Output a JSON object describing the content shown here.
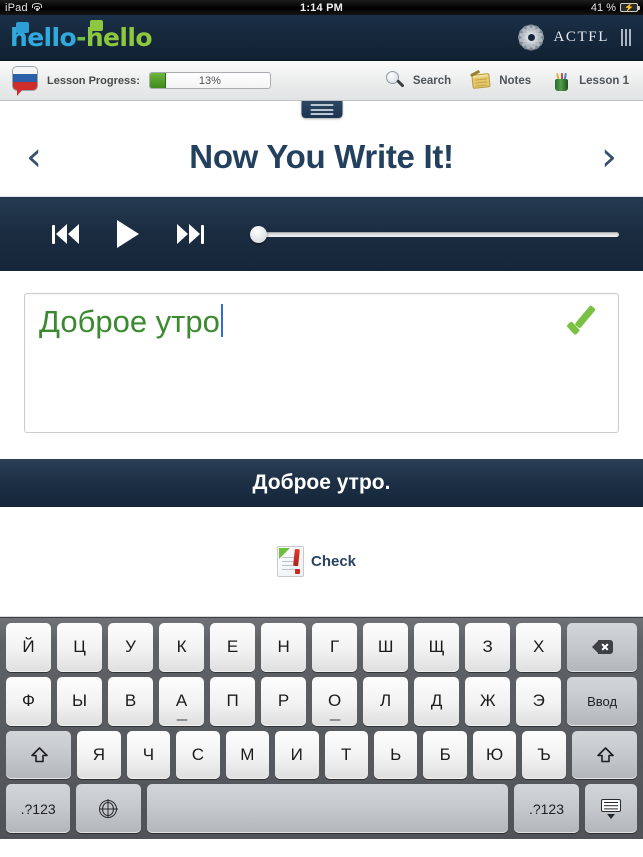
{
  "status_bar": {
    "device": "iPad",
    "wifi_icon": "wifi-icon",
    "time": "1:14 PM",
    "battery_percent": "41 %",
    "battery_icon": "battery-charging-icon"
  },
  "brand_bar": {
    "logo_part1": "hello",
    "logo_dash": "-",
    "logo_part2": "hello",
    "partner_name": "ACTFL",
    "partner_mark_icon": "actfl-rosette-icon",
    "menu_bars_icon": "menu-bars-icon"
  },
  "toolbar": {
    "language_flag_icon": "russian-flag-bubble-icon",
    "progress_label": "Lesson Progress:",
    "progress_percent": "13%",
    "progress_value": 13,
    "items": [
      {
        "label": "Search",
        "icon": "search-icon"
      },
      {
        "label": "Notes",
        "icon": "notes-icon"
      },
      {
        "label": "Lesson 1",
        "icon": "pencil-cup-icon"
      }
    ]
  },
  "title_section": {
    "drawer_handle_icon": "drawer-handle-icon",
    "prev_arrow": "‹",
    "next_arrow": "›",
    "title": "Now You Write It!"
  },
  "player": {
    "rewind_icon": "skip-back-icon",
    "play_icon": "play-icon",
    "forward_icon": "skip-forward-icon",
    "scrub_position_percent": 0
  },
  "answer": {
    "typed_text": "Доброе утро",
    "placeholder": "",
    "correct_icon": "green-checkmark-icon",
    "text_color": "#3b8a30",
    "caret_color": "#2f6fd0"
  },
  "prompt_banner": {
    "text": "Доброе утро."
  },
  "check_button": {
    "label": "Check",
    "icon": "check-document-icon"
  },
  "keyboard": {
    "layout": "russian",
    "rows": [
      {
        "keys": [
          {
            "label": "Й",
            "type": "letter"
          },
          {
            "label": "Ц",
            "type": "letter"
          },
          {
            "label": "У",
            "type": "letter"
          },
          {
            "label": "К",
            "type": "letter"
          },
          {
            "label": "Е",
            "type": "letter"
          },
          {
            "label": "Н",
            "type": "letter"
          },
          {
            "label": "Г",
            "type": "letter"
          },
          {
            "label": "Ш",
            "type": "letter"
          },
          {
            "label": "Щ",
            "type": "letter"
          },
          {
            "label": "З",
            "type": "letter"
          },
          {
            "label": "Х",
            "type": "letter"
          },
          {
            "label": "",
            "type": "backspace",
            "icon": "backspace-icon"
          }
        ]
      },
      {
        "keys": [
          {
            "label": "Ф",
            "type": "letter"
          },
          {
            "label": "Ы",
            "type": "letter"
          },
          {
            "label": "В",
            "type": "letter"
          },
          {
            "label": "А",
            "type": "letter",
            "home": true
          },
          {
            "label": "П",
            "type": "letter"
          },
          {
            "label": "Р",
            "type": "letter"
          },
          {
            "label": "О",
            "type": "letter",
            "home": true
          },
          {
            "label": "Л",
            "type": "letter"
          },
          {
            "label": "Д",
            "type": "letter"
          },
          {
            "label": "Ж",
            "type": "letter"
          },
          {
            "label": "Э",
            "type": "letter"
          },
          {
            "label": "Ввод",
            "type": "enter"
          }
        ]
      },
      {
        "keys": [
          {
            "label": "",
            "type": "shift",
            "icon": "shift-icon"
          },
          {
            "label": "Я",
            "type": "letter"
          },
          {
            "label": "Ч",
            "type": "letter"
          },
          {
            "label": "С",
            "type": "letter"
          },
          {
            "label": "М",
            "type": "letter"
          },
          {
            "label": "И",
            "type": "letter"
          },
          {
            "label": "Т",
            "type": "letter"
          },
          {
            "label": "Ь",
            "type": "letter"
          },
          {
            "label": "Б",
            "type": "letter"
          },
          {
            "label": "Ю",
            "type": "letter"
          },
          {
            "label": "Ъ",
            "type": "letter"
          },
          {
            "label": "",
            "type": "shift",
            "icon": "shift-icon"
          }
        ]
      },
      {
        "keys": [
          {
            "label": ".?123",
            "type": "numeric"
          },
          {
            "label": "",
            "type": "globe",
            "icon": "globe-icon"
          },
          {
            "label": "",
            "type": "space"
          },
          {
            "label": ".?123",
            "type": "numeric"
          },
          {
            "label": "",
            "type": "hide",
            "icon": "hide-keyboard-icon"
          }
        ]
      }
    ]
  },
  "colors": {
    "brand_dark": "#16293d",
    "accent_blue": "#31a9dd",
    "accent_green": "#8dc63f",
    "title_navy": "#23415f",
    "progress_green": "#3f8a1e"
  }
}
